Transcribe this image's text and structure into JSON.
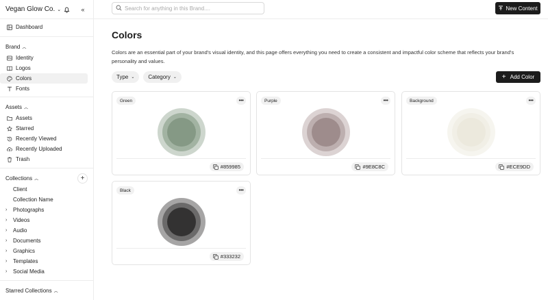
{
  "brand": {
    "name": "Vegan Glow Co."
  },
  "topbar": {
    "search_placeholder": "Search for anything in this Brand....",
    "new_content_label": "New Content"
  },
  "sidebar": {
    "dashboard_label": "Dashboard",
    "brand_section": {
      "label": "Brand",
      "items": [
        "Identity",
        "Logos",
        "Colors",
        "Fonts"
      ],
      "active": "Colors"
    },
    "assets_section": {
      "label": "Assets",
      "items": [
        "Assets",
        "Starred",
        "Recently Viewed",
        "Recently Uploaded",
        "Trash"
      ]
    },
    "collections_section": {
      "label": "Collections",
      "items": [
        "Client",
        "Collection Name",
        "Photographs",
        "Videos",
        "Audio",
        "Documents",
        "Graphics",
        "Templates",
        "Social Media"
      ]
    },
    "starred_collections_label": "Starred Collections"
  },
  "main": {
    "title": "Colors",
    "description": "Colors are an essential part of your brand's visual identity, and this page offers everything you need to create a consistent and impactful color scheme that reflects your brand's personality and values.",
    "filters": {
      "type_label": "Type",
      "category_label": "Category"
    },
    "add_color_label": "Add Color",
    "colors": [
      {
        "name": "Green",
        "hex_label": "#859985",
        "outer": "#cdd6cd",
        "mid": "#a2b3a2",
        "inner": "#859985"
      },
      {
        "name": "Purple",
        "hex_label": "#9E8C8C",
        "outer": "#dcd3d3",
        "mid": "#bdafaf",
        "inner": "#9e8c8c"
      },
      {
        "name": "Background",
        "hex_label": "#ECE9DD",
        "outer": "#f6f5ef",
        "mid": "#f1efe6",
        "inner": "#ece9dd"
      },
      {
        "name": "Black",
        "hex_label": "#333232",
        "outer": "#a6a5a5",
        "mid": "#6b6a6a",
        "inner": "#333232"
      }
    ]
  }
}
